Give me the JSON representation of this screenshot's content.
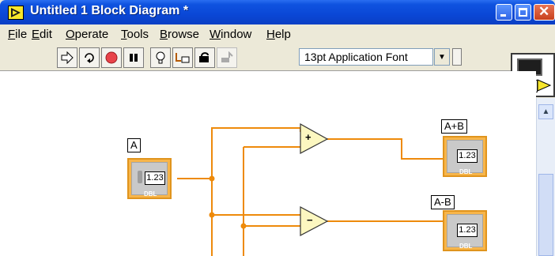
{
  "window": {
    "title": "Untitled 1 Block Diagram *"
  },
  "menu": [
    {
      "label": "File",
      "acc": "F",
      "rest": "ile"
    },
    {
      "label": "Edit",
      "acc": "E",
      "rest": "dit"
    },
    {
      "label": "Operate",
      "acc": "O",
      "rest": "perate"
    },
    {
      "label": "Tools",
      "acc": "T",
      "rest": "ools"
    },
    {
      "label": "Browse",
      "acc": "B",
      "rest": "rowse"
    },
    {
      "label": "Window",
      "acc": "W",
      "rest": "indow"
    },
    {
      "label": "Help",
      "acc": "H",
      "rest": "elp"
    }
  ],
  "toolbar": {
    "font": "13pt Application Font"
  },
  "vi_icon": {
    "number": "1"
  },
  "diagram": {
    "control_a": {
      "label": "A",
      "value": "1.23",
      "type": "DBL"
    },
    "add": {
      "symbol": "+"
    },
    "subtract": {
      "symbol": "−"
    },
    "indicator_sum": {
      "label": "A+B",
      "value": "1.23",
      "type": "DBL"
    },
    "indicator_diff": {
      "label": "A-B",
      "value": "1.23",
      "type": "DBL"
    }
  },
  "colors": {
    "titlebar": "#0a47d6",
    "wire": "#ee8a0b",
    "terminal": "#f7b54a"
  }
}
